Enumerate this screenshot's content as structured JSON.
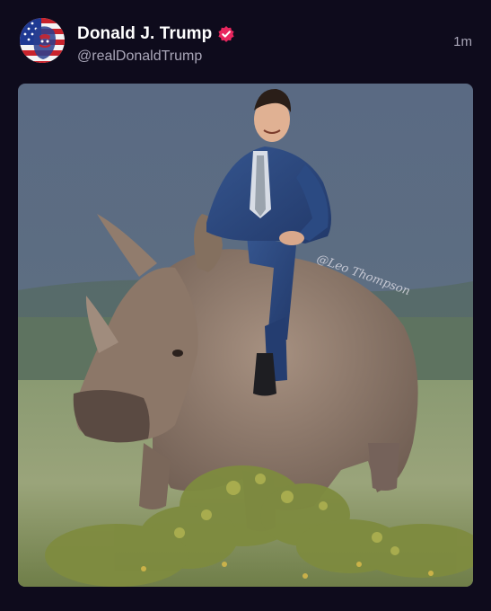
{
  "post": {
    "author": {
      "display_name": "Donald J. Trump",
      "handle": "@realDonaldTrump",
      "verified": true,
      "avatar_icon": "flag-portrait-avatar"
    },
    "timestamp": "1m",
    "media": {
      "watermark": "@Leo Thompson",
      "alt_description": "photo of a smiling man in a blue suit riding on a rhino in a grassy field"
    }
  },
  "colors": {
    "background": "#0e0b1c",
    "name_text": "#ffffff",
    "secondary_text": "#a9a6b8",
    "verified_badge": "#e8265e"
  }
}
